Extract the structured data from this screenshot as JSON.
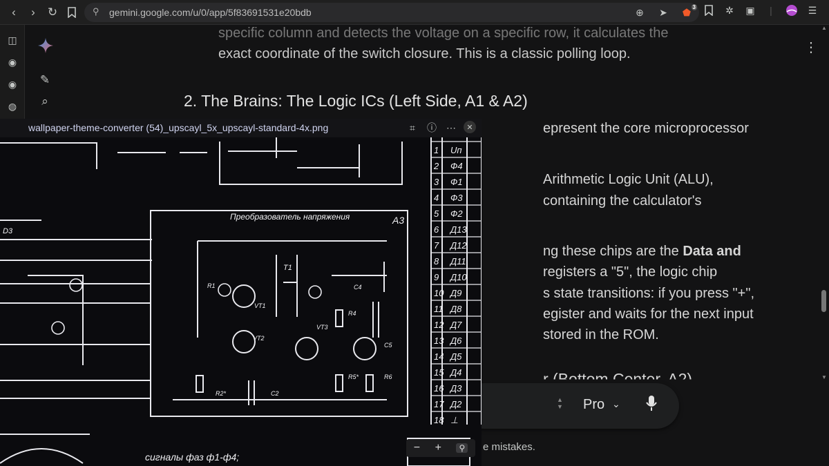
{
  "browser": {
    "url": "gemini.google.com/u/0/app/5f83691531e20bdb",
    "back_icon": "chevron-left-icon",
    "badge_count": "3"
  },
  "conversation": {
    "intro_lines": [
      "specific column and detects the voltage on a specific row, it calculates the",
      "exact coordinate of the switch closure. This is a classic polling loop."
    ],
    "heading": "2. The Brains: The Logic ICs (Left Side, A1 & A2)",
    "visible_fragments": [
      "epresent the core microprocessor",
      "Arithmetic Logic Unit (ALU),",
      "containing the calculator's",
      "ng these chips are the ",
      "Data and",
      "registers a \"5\", the logic chip",
      "s state transitions: if you press \"+\",",
      "egister and waits for the next input",
      "stored in the ROM.",
      "r (Bottom Center, A2)"
    ],
    "disclaimer": "e mistakes."
  },
  "composer": {
    "model": "Pro"
  },
  "image_viewer": {
    "filename": "wallpaper-theme-converter (54)_upscayl_5x_upscayl-standard-4x.png",
    "schematic_labels": {
      "a3": "A3",
      "title": "Преобразователь напряжения",
      "bottom_text": "сигналы фаз ф1-ф4;",
      "d3": "D3",
      "t1": "T1",
      "vt1": "VT1",
      "vt2": "VT2",
      "vt3": "VT3",
      "r1": "R1",
      "r2": "R2*",
      "c2": "C2",
      "c4": "C4",
      "c5": "C5",
      "r4": "R4",
      "r5": "R5*",
      "r6": "R6"
    },
    "table_rows": [
      [
        "1",
        "Uп"
      ],
      [
        "2",
        "Ф4"
      ],
      [
        "3",
        "Ф1"
      ],
      [
        "4",
        "Ф3"
      ],
      [
        "5",
        "Ф2"
      ],
      [
        "6",
        "Д13"
      ],
      [
        "7",
        "Д12"
      ],
      [
        "8",
        "Д11"
      ],
      [
        "9",
        "Д10"
      ],
      [
        "10",
        "Д9"
      ],
      [
        "11",
        "Д8"
      ],
      [
        "12",
        "Д7"
      ],
      [
        "13",
        "Д6"
      ],
      [
        "14",
        "Д5"
      ],
      [
        "15",
        "Д4"
      ],
      [
        "16",
        "Д3"
      ],
      [
        "17",
        "Д2"
      ],
      [
        "18",
        "⊥"
      ]
    ],
    "zoom_minus": "−",
    "zoom_plus": "+"
  }
}
